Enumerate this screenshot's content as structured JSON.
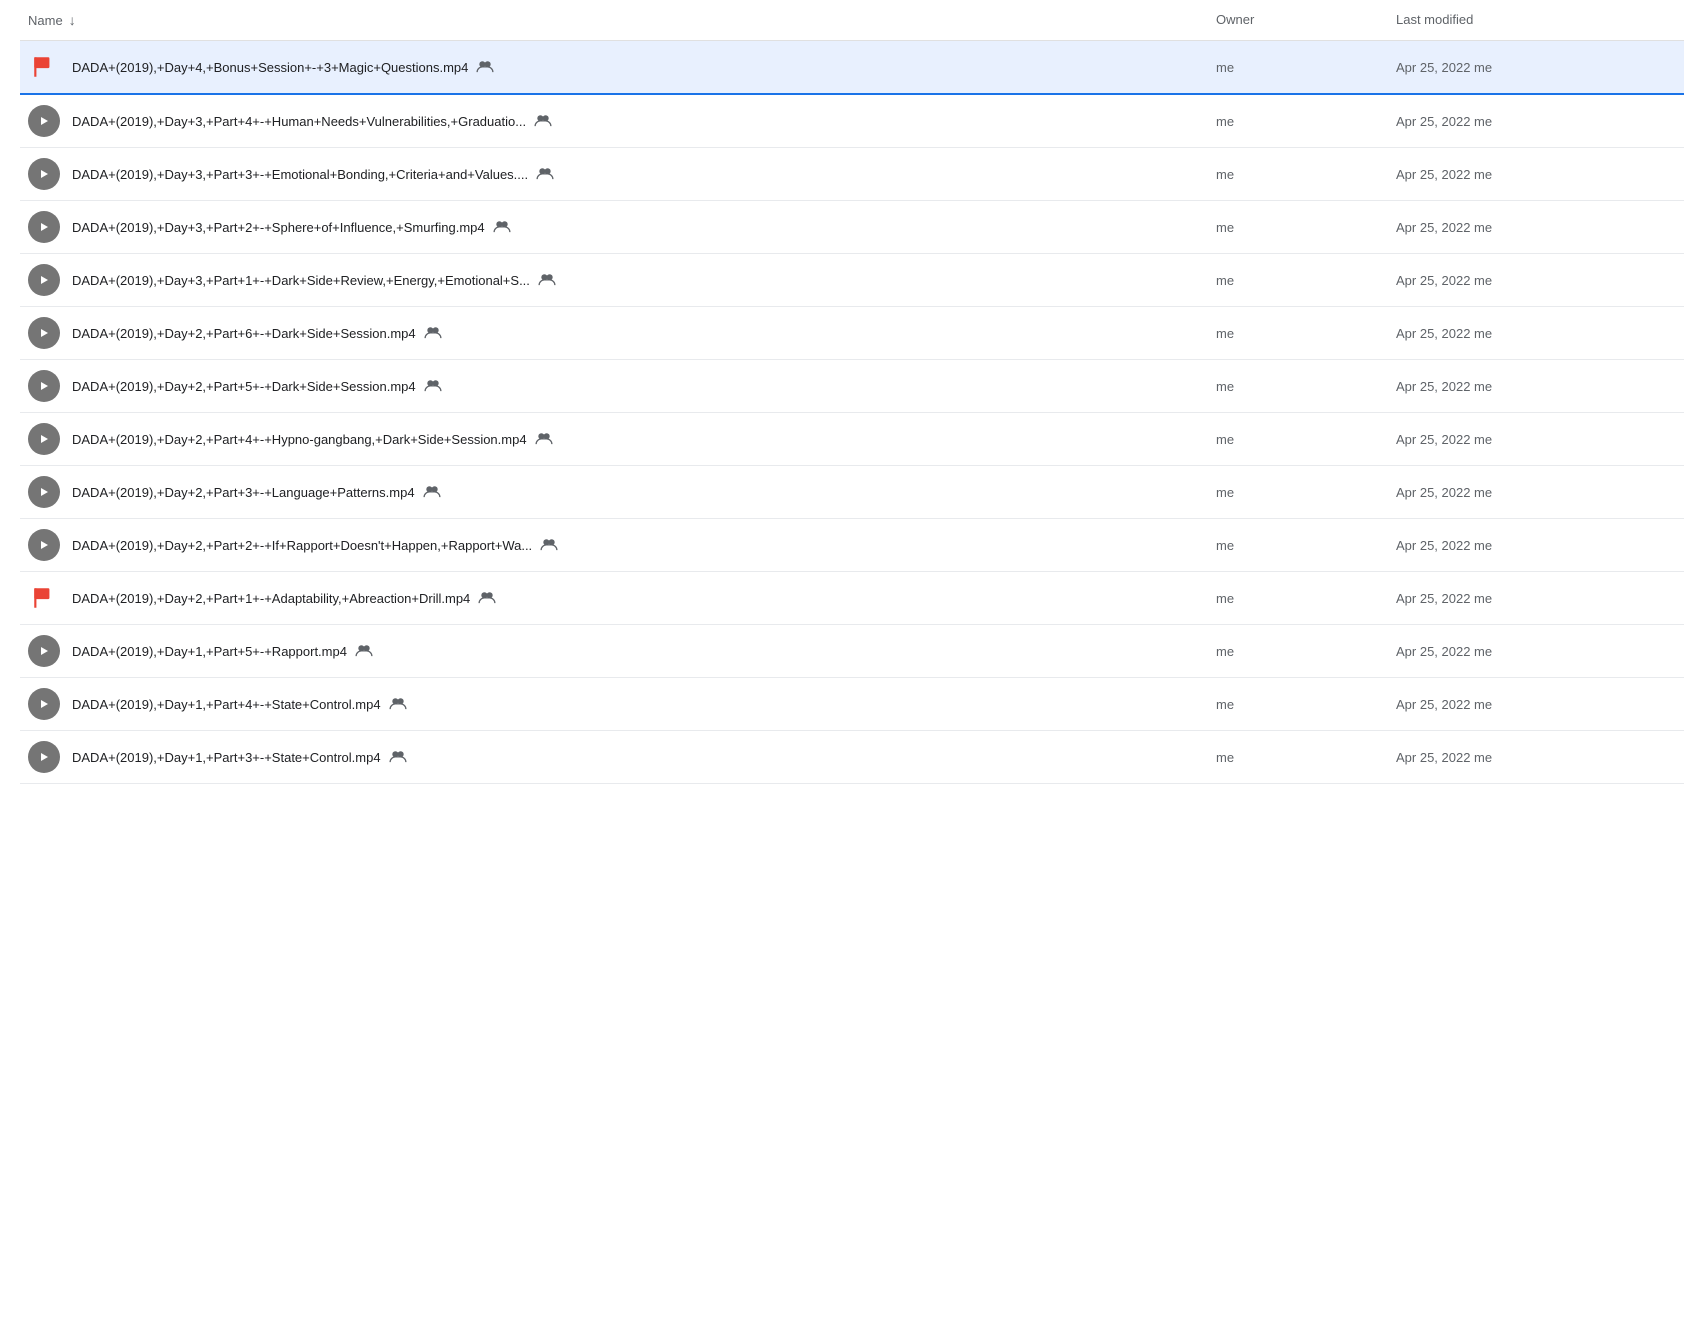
{
  "header": {
    "name_label": "Name",
    "owner_label": "Owner",
    "modified_label": "Last modified"
  },
  "rows": [
    {
      "id": 1,
      "icon_type": "flag",
      "name": "DADA+(2019),+Day+4,+Bonus+Session+-+3+Magic+Questions.mp4",
      "truncated": false,
      "owner": "me",
      "modified": "Apr 25, 2022",
      "modified_by": "me",
      "selected": true
    },
    {
      "id": 2,
      "icon_type": "play",
      "name": "DADA+(2019),+Day+3,+Part+4+-+Human+Needs+Vulnerabilities,+Graduatio...",
      "truncated": true,
      "owner": "me",
      "modified": "Apr 25, 2022",
      "modified_by": "me",
      "selected": false
    },
    {
      "id": 3,
      "icon_type": "play",
      "name": "DADA+(2019),+Day+3,+Part+3+-+Emotional+Bonding,+Criteria+and+Values....",
      "truncated": true,
      "owner": "me",
      "modified": "Apr 25, 2022",
      "modified_by": "me",
      "selected": false
    },
    {
      "id": 4,
      "icon_type": "play",
      "name": "DADA+(2019),+Day+3,+Part+2+-+Sphere+of+Influence,+Smurfing.mp4",
      "truncated": false,
      "owner": "me",
      "modified": "Apr 25, 2022",
      "modified_by": "me",
      "selected": false
    },
    {
      "id": 5,
      "icon_type": "play",
      "name": "DADA+(2019),+Day+3,+Part+1+-+Dark+Side+Review,+Energy,+Emotional+S...",
      "truncated": true,
      "owner": "me",
      "modified": "Apr 25, 2022",
      "modified_by": "me",
      "selected": false
    },
    {
      "id": 6,
      "icon_type": "play",
      "name": "DADA+(2019),+Day+2,+Part+6+-+Dark+Side+Session.mp4",
      "truncated": false,
      "owner": "me",
      "modified": "Apr 25, 2022",
      "modified_by": "me",
      "selected": false
    },
    {
      "id": 7,
      "icon_type": "play",
      "name": "DADA+(2019),+Day+2,+Part+5+-+Dark+Side+Session.mp4",
      "truncated": false,
      "owner": "me",
      "modified": "Apr 25, 2022",
      "modified_by": "me",
      "selected": false
    },
    {
      "id": 8,
      "icon_type": "play",
      "name": "DADA+(2019),+Day+2,+Part+4+-+Hypno-gangbang,+Dark+Side+Session.mp4",
      "truncated": false,
      "owner": "me",
      "modified": "Apr 25, 2022",
      "modified_by": "me",
      "selected": false
    },
    {
      "id": 9,
      "icon_type": "play",
      "name": "DADA+(2019),+Day+2,+Part+3+-+Language+Patterns.mp4",
      "truncated": false,
      "owner": "me",
      "modified": "Apr 25, 2022",
      "modified_by": "me",
      "selected": false
    },
    {
      "id": 10,
      "icon_type": "play",
      "name": "DADA+(2019),+Day+2,+Part+2+-+If+Rapport+Doesn't+Happen,+Rapport+Wa...",
      "truncated": true,
      "owner": "me",
      "modified": "Apr 25, 2022",
      "modified_by": "me",
      "selected": false
    },
    {
      "id": 11,
      "icon_type": "flag",
      "name": "DADA+(2019),+Day+2,+Part+1+-+Adaptability,+Abreaction+Drill.mp4",
      "truncated": false,
      "owner": "me",
      "modified": "Apr 25, 2022",
      "modified_by": "me",
      "selected": false
    },
    {
      "id": 12,
      "icon_type": "play",
      "name": "DADA+(2019),+Day+1,+Part+5+-+Rapport.mp4",
      "truncated": false,
      "owner": "me",
      "modified": "Apr 25, 2022",
      "modified_by": "me",
      "selected": false
    },
    {
      "id": 13,
      "icon_type": "play",
      "name": "DADA+(2019),+Day+1,+Part+4+-+State+Control.mp4",
      "truncated": false,
      "owner": "me",
      "modified": "Apr 25, 2022",
      "modified_by": "me",
      "selected": false
    },
    {
      "id": 14,
      "icon_type": "play",
      "name": "DADA+(2019),+Day+1,+Part+3+-+State+Control.mp4",
      "truncated": false,
      "owner": "me",
      "modified": "Apr 25, 2022",
      "modified_by": "me",
      "selected": false
    }
  ]
}
